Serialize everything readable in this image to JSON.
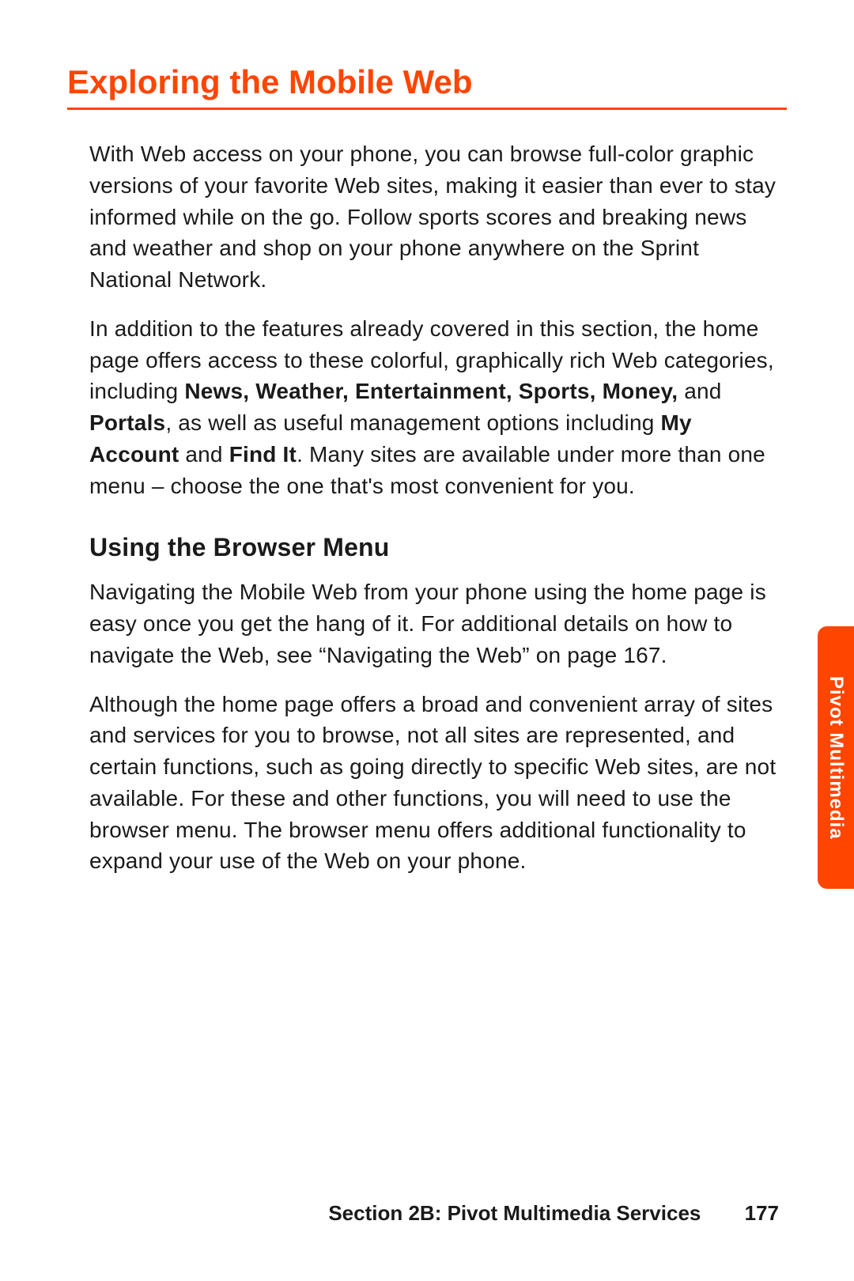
{
  "title": "Exploring the Mobile Web",
  "para1": "With Web access on your phone, you can browse full-color graphic versions of your favorite Web sites, making it easier than ever to stay informed while on the go. Follow sports scores and breaking news and weather and shop on your phone anywhere on the Sprint National Network.",
  "para2_a": "In addition to the features already covered in this section, the home page offers access to these colorful, graphically rich Web categories, including ",
  "para2_bold1": "News, Weather, Entertainment, Sports, Money,",
  "para2_b": " and ",
  "para2_bold2": "Portals",
  "para2_c": ", as well as useful management options including ",
  "para2_bold3": "My Account",
  "para2_d": " and ",
  "para2_bold4": "Find It",
  "para2_e": ". Many sites are available under more than one menu – choose the one that's most convenient for you.",
  "subheading": "Using the Browser Menu",
  "para3": "Navigating the Mobile Web from your phone using the home page is easy once you get the hang of it. For additional details on how to navigate the Web, see “Navigating the Web” on page 167.",
  "para4": "Although the home page offers a broad and convenient array of sites and services for you to browse, not all sites are represented, and certain functions, such as going directly to specific Web sites, are not available. For these and other functions, you will need to use the browser menu. The browser menu offers additional functionality to expand your use of the Web on your phone.",
  "sidetab": "Pivot Multimedia",
  "footer_section": "Section 2B: Pivot Multimedia Services",
  "footer_page": "177"
}
